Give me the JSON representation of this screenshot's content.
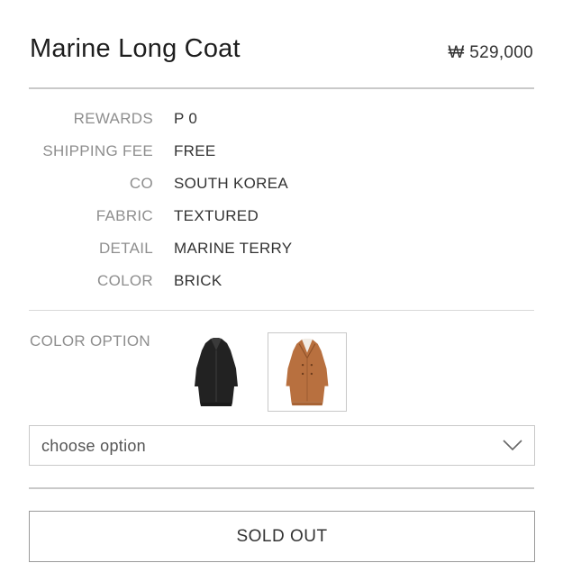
{
  "product": {
    "title": "Marine Long Coat",
    "price": "₩ 529,000"
  },
  "specs": [
    {
      "label": "REWARDS",
      "value": "P 0"
    },
    {
      "label": "SHIPPING FEE",
      "value": "FREE"
    },
    {
      "label": "CO",
      "value": "SOUTH KOREA"
    },
    {
      "label": "FABRIC",
      "value": "TEXTURED"
    },
    {
      "label": "DETAIL",
      "value": "MARINE TERRY"
    },
    {
      "label": "COLOR",
      "value": "BRICK"
    }
  ],
  "color_option": {
    "label": "COLOR OPTION",
    "swatches": [
      {
        "color_hex": "#222222",
        "selected": false
      },
      {
        "color_hex": "#b8703f",
        "selected": true
      }
    ]
  },
  "select": {
    "placeholder": "choose option",
    "icon": "chevron-down-icon"
  },
  "buy_button": {
    "label": "SOLD OUT"
  }
}
